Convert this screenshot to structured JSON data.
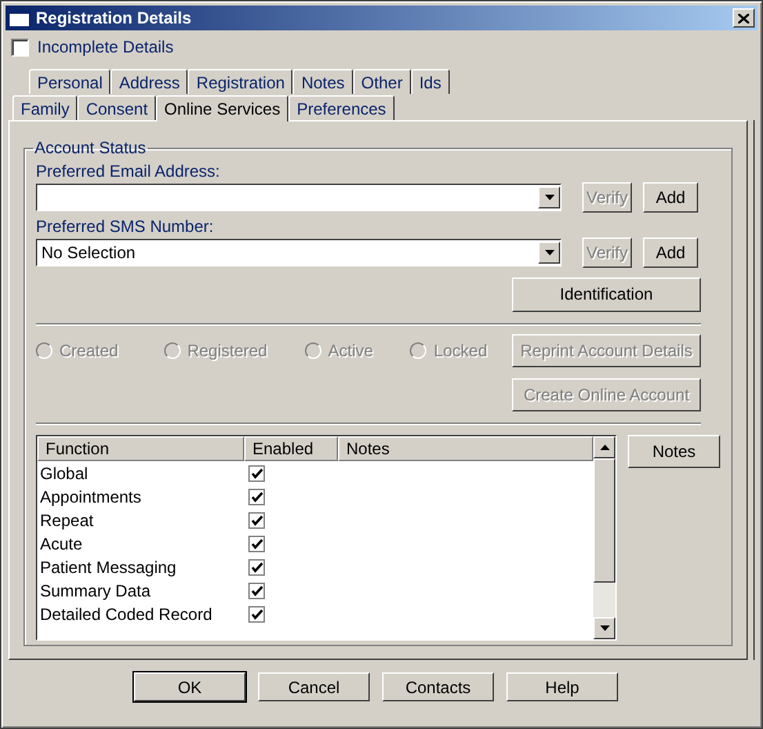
{
  "window": {
    "title": "Registration Details"
  },
  "incomplete": {
    "label": "Incomplete Details",
    "checked": false
  },
  "tabs_back": [
    {
      "label": "Personal",
      "selected": false
    },
    {
      "label": "Address",
      "selected": false
    },
    {
      "label": "Registration",
      "selected": false
    },
    {
      "label": "Notes",
      "selected": false
    },
    {
      "label": "Other",
      "selected": false
    },
    {
      "label": "Ids",
      "selected": false
    }
  ],
  "tabs_front": [
    {
      "label": "Family",
      "selected": false
    },
    {
      "label": "Consent",
      "selected": false
    },
    {
      "label": "Online Services",
      "selected": true
    },
    {
      "label": "Preferences",
      "selected": false
    }
  ],
  "account_status": {
    "title": "Account Status",
    "fields": [
      {
        "label": "Preferred Email Address:",
        "verify": {
          "label": "Verify",
          "disabled": true
        },
        "add": {
          "label": "Add",
          "disabled": false
        }
      },
      {
        "label": "Preferred SMS Number:",
        "value": "No Selection",
        "verify": {
          "label": "Verify",
          "disabled": true
        },
        "add": {
          "label": "Add",
          "disabled": false
        }
      }
    ],
    "identification": {
      "label": "Identification",
      "disabled": false
    },
    "radios": [
      {
        "label": "Created",
        "selected": false,
        "disabled": true
      },
      {
        "label": "Registered",
        "selected": false,
        "disabled": true
      },
      {
        "label": "Active",
        "selected": false,
        "disabled": true
      },
      {
        "label": "Locked",
        "selected": false,
        "disabled": true
      }
    ],
    "actions": [
      {
        "label": "Reprint Account Details",
        "disabled": true
      },
      {
        "label": "Create Online Account",
        "disabled": true
      }
    ],
    "table": {
      "columns": [
        "Function",
        "Enabled",
        "Notes"
      ],
      "rows": [
        {
          "function": "Global",
          "enabled": true
        },
        {
          "function": "Appointments",
          "enabled": true
        },
        {
          "function": "Repeat",
          "enabled": true
        },
        {
          "function": "Acute",
          "enabled": true
        },
        {
          "function": "Patient Messaging",
          "enabled": true
        },
        {
          "function": "Summary Data",
          "enabled": true
        },
        {
          "function": "Detailed Coded Record",
          "enabled": true
        }
      ]
    },
    "notes_button": "Notes"
  },
  "buttons": [
    {
      "label": "OK",
      "default": true
    },
    {
      "label": "Cancel",
      "default": false
    },
    {
      "label": "Contacts",
      "default": false
    },
    {
      "label": "Help",
      "default": false
    }
  ]
}
